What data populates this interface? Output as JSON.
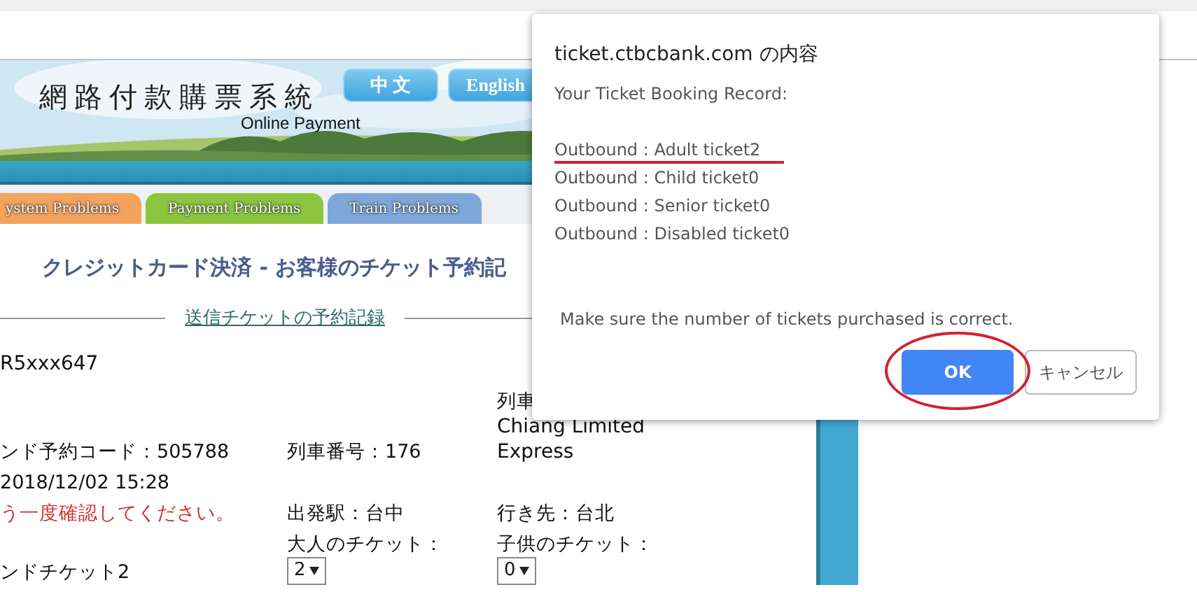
{
  "header": {
    "title": "網路付款購票系統",
    "subtitle": "Online Payment",
    "language_buttons": [
      "中 文",
      "English"
    ]
  },
  "tabs": [
    {
      "label": "ystem Problems",
      "color": "#f3a35c"
    },
    {
      "label": "Payment Problems",
      "color": "#8cc63f"
    },
    {
      "label": "Train Problems",
      "color": "#7fa7d9"
    }
  ],
  "heading": "クレジットカード決済 - お客様のチケット予約記",
  "section_link": "送信チケットの予約記録",
  "reference": "R5xxx647",
  "details": [
    {
      "column_1": {
        "text": "ンド予約コード：505788",
        "kind": "text"
      },
      "column_2": {
        "text": "列車番号：176",
        "kind": "text"
      },
      "column_3": {
        "label": "列車",
        "text": "Chiang Limited Express",
        "kind": "text"
      }
    },
    {
      "column_1": {
        "text": "2018/12/02 15:28",
        "kind": "text"
      }
    },
    {
      "column_1": {
        "text": "う一度確認してください。",
        "kind": "warning"
      },
      "column_2": {
        "text": "出発駅：台中",
        "kind": "text"
      },
      "column_3": {
        "text": "行き先：台北",
        "kind": "text"
      }
    },
    {
      "column_1": {
        "text": "ンドチケット2",
        "kind": "text"
      },
      "column_2": {
        "label": "大人のチケット：",
        "text": "2",
        "kind": "select"
      },
      "column_3": {
        "label": "子供のチケット：",
        "text": "0",
        "kind": "select"
      }
    }
  ],
  "dialog": {
    "title": "ticket.ctbcbank.com の内容",
    "intro": "Your Ticket Booking Record:",
    "lines": [
      {
        "text": "Outbound : Adult ticket2",
        "underlined": true
      },
      {
        "text": "Outbound : Child ticket0",
        "underlined": false
      },
      {
        "text": "Outbound : Senior ticket0",
        "underlined": false
      },
      {
        "text": "Outbound : Disabled ticket0",
        "underlined": false
      }
    ],
    "note": "Make sure the number of tickets purchased is correct.",
    "buttons": [
      {
        "label": "OK",
        "kind": "primary",
        "circled": true
      },
      {
        "label": "キャンセル",
        "kind": "secondary",
        "circled": false
      }
    ]
  }
}
